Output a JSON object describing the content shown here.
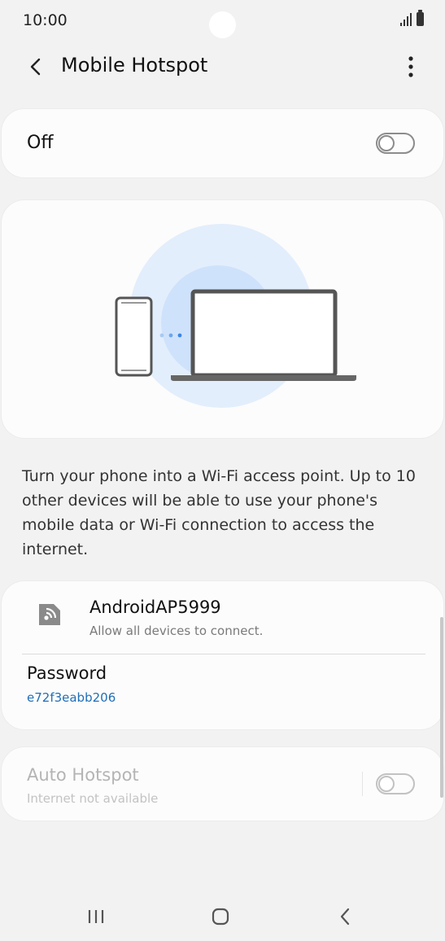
{
  "status_bar": {
    "time": "10:00"
  },
  "header": {
    "title": "Mobile Hotspot"
  },
  "hotspot_toggle": {
    "label": "Off",
    "state": "off"
  },
  "description": "Turn your phone into a Wi-Fi access point. Up to 10 other devices will be able to use your phone's mobile data or Wi-Fi connection to access the internet.",
  "network": {
    "name": "AndroidAP5999",
    "subtitle": "Allow all devices to connect.",
    "password_label": "Password",
    "password_value": "e72f3eabb206"
  },
  "auto_hotspot": {
    "title": "Auto Hotspot",
    "subtitle": "Internet not available",
    "state": "off",
    "enabled": false
  },
  "colors": {
    "background": "#f2f2f2",
    "card": "#fcfcfc",
    "accent_link": "#1f6fb8",
    "illustration_glow": "#cfe2fb"
  },
  "icons": {
    "back": "back-arrow-icon",
    "more": "more-options-icon",
    "network": "wifi-hotspot-icon",
    "phone": "phone-illustration-icon",
    "laptop": "laptop-illustration-icon"
  }
}
